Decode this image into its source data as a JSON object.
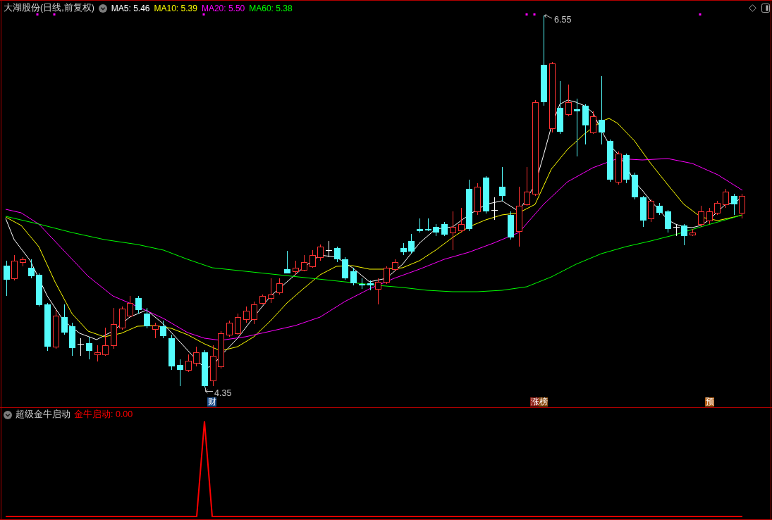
{
  "chart_header": {
    "title": "大湖股份(日线,前复权)",
    "moving_averages": [
      {
        "text": "MA5: 5.46",
        "color": "#ffffff"
      },
      {
        "text": "MA10: 5.39",
        "color": "#ffff00"
      },
      {
        "text": "MA20: 5.50",
        "color": "#ff00ff"
      },
      {
        "text": "MA60: 5.38",
        "color": "#00ff00"
      }
    ]
  },
  "price_chart": {
    "high_label": "6.55",
    "low_label": "4.35",
    "event_tags": [
      {
        "text": "财",
        "color": "#1c4f8c"
      },
      {
        "text": "涨",
        "color": "#8b1a10"
      },
      {
        "text": "榜",
        "color": "#8b4c10"
      },
      {
        "text": "预",
        "color": "#b05c12"
      }
    ]
  },
  "indicator_panel": {
    "title": "超级金牛启动",
    "outputs": [
      {
        "text": "金牛启动: 0.00",
        "color": "#ff0000"
      }
    ]
  }
}
